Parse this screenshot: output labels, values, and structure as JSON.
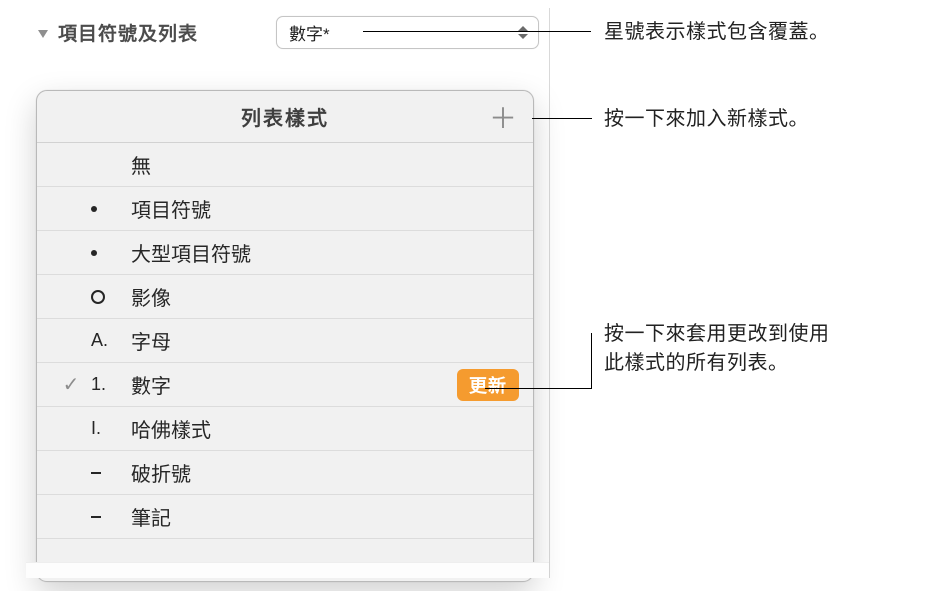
{
  "header": {
    "section_label": "項目符號及列表",
    "dropdown_value": "數字*"
  },
  "popover": {
    "title": "列表樣式",
    "add_glyph": "＋",
    "items": [
      {
        "marker": "",
        "label": "無",
        "checked": false
      },
      {
        "marker": "bullet",
        "label": "項目符號",
        "checked": false
      },
      {
        "marker": "bullet",
        "label": "大型項目符號",
        "checked": false
      },
      {
        "marker": "circle",
        "label": "影像",
        "checked": false
      },
      {
        "marker": "A.",
        "label": "字母",
        "checked": false
      },
      {
        "marker": "1.",
        "label": "數字",
        "checked": true,
        "update": true
      },
      {
        "marker": "I.",
        "label": "哈佛樣式",
        "checked": false
      },
      {
        "marker": "dash",
        "label": "破折號",
        "checked": false
      },
      {
        "marker": "dash",
        "label": "筆記",
        "checked": false
      }
    ],
    "update_label": "更新",
    "check_glyph": "✓"
  },
  "callouts": {
    "asterisk": "星號表示樣式包含覆蓋。",
    "add": "按一下來加入新樣式。",
    "update_line1": "按一下來套用更改到使用",
    "update_line2": "此樣式的所有列表。"
  }
}
